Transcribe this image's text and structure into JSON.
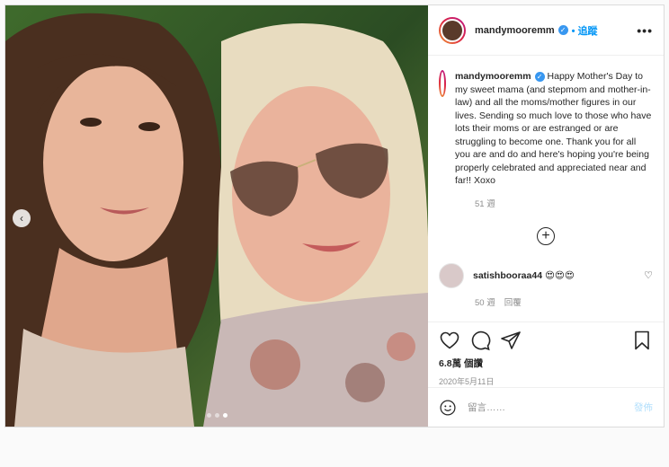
{
  "post": {
    "username": "mandymooremm",
    "follow_label": "追蹤",
    "more_label": "•••",
    "caption": "Happy Mother's Day to my sweet mama (and stepmom and mother-in-law) and all the moms/mother figures in our lives. Sending so much love to those who have lots their moms or are estranged or are struggling to become one. Thank you for all you are and do and here's hoping you're being properly celebrated and appreciated near and far!! Xoxo",
    "caption_age": "51 週",
    "load_more": "+",
    "comment": {
      "username": "satishbooraa44",
      "text": "😍😍😍",
      "age": "50 週",
      "reply_label": "回覆"
    },
    "views": "6.8萬 個讚",
    "date": "2020年5月11日",
    "comment_placeholder": "留言……",
    "post_button": "發佈",
    "carousel": {
      "slides": 3,
      "active": 2
    }
  }
}
